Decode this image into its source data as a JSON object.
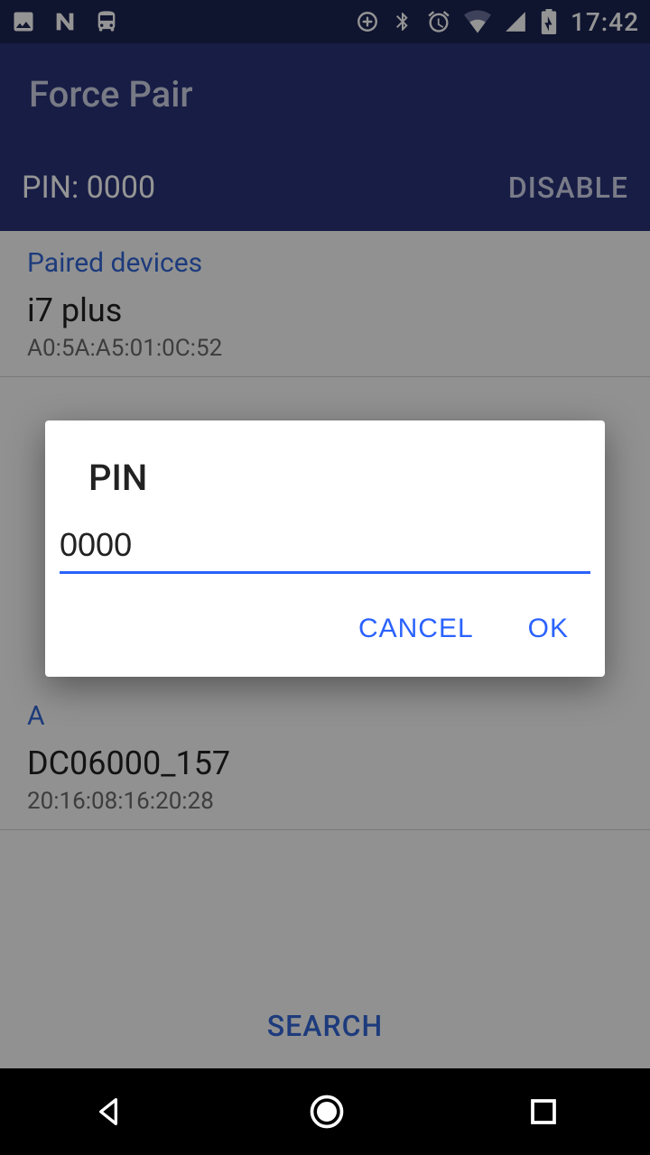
{
  "statusbar": {
    "clock": "17:42"
  },
  "appbar": {
    "title": "Force Pair"
  },
  "pinbar": {
    "label": "PIN: 0000",
    "action": "DISABLE"
  },
  "sections": {
    "paired_header": "Paired devices",
    "available_header": "A"
  },
  "devices": {
    "paired": [
      {
        "name": "i7 plus",
        "mac": "A0:5A:A5:01:0C:52"
      }
    ],
    "available": [
      {
        "name": "DC06000_157",
        "mac": "20:16:08:16:20:28"
      }
    ]
  },
  "search": {
    "label": "SEARCH"
  },
  "dialog": {
    "title": "PIN",
    "value": "0000",
    "cancel": "CANCEL",
    "ok": "OK"
  }
}
